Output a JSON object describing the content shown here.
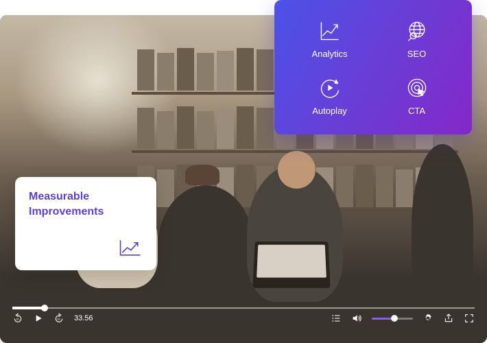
{
  "feature_panel": {
    "items": [
      {
        "label": "Analytics",
        "icon": "analytics-chart-icon"
      },
      {
        "label": "SEO",
        "icon": "seo-globe-search-icon"
      },
      {
        "label": "Autoplay",
        "icon": "autoplay-icon"
      },
      {
        "label": "CTA",
        "icon": "cta-target-icon"
      }
    ]
  },
  "card": {
    "title": "Measurable Improvements",
    "icon": "trend-up-icon"
  },
  "player": {
    "progress_percent": 7,
    "time_current": "33.56",
    "time_total": "",
    "rewind_seconds": "10",
    "forward_seconds": "10",
    "volume_percent": 55
  },
  "colors": {
    "accent_purple": "#5b3fd6",
    "panel_gradient_from": "#4a52e8",
    "panel_gradient_to": "#8428c8",
    "volume_fill": "#8a5cf0"
  }
}
